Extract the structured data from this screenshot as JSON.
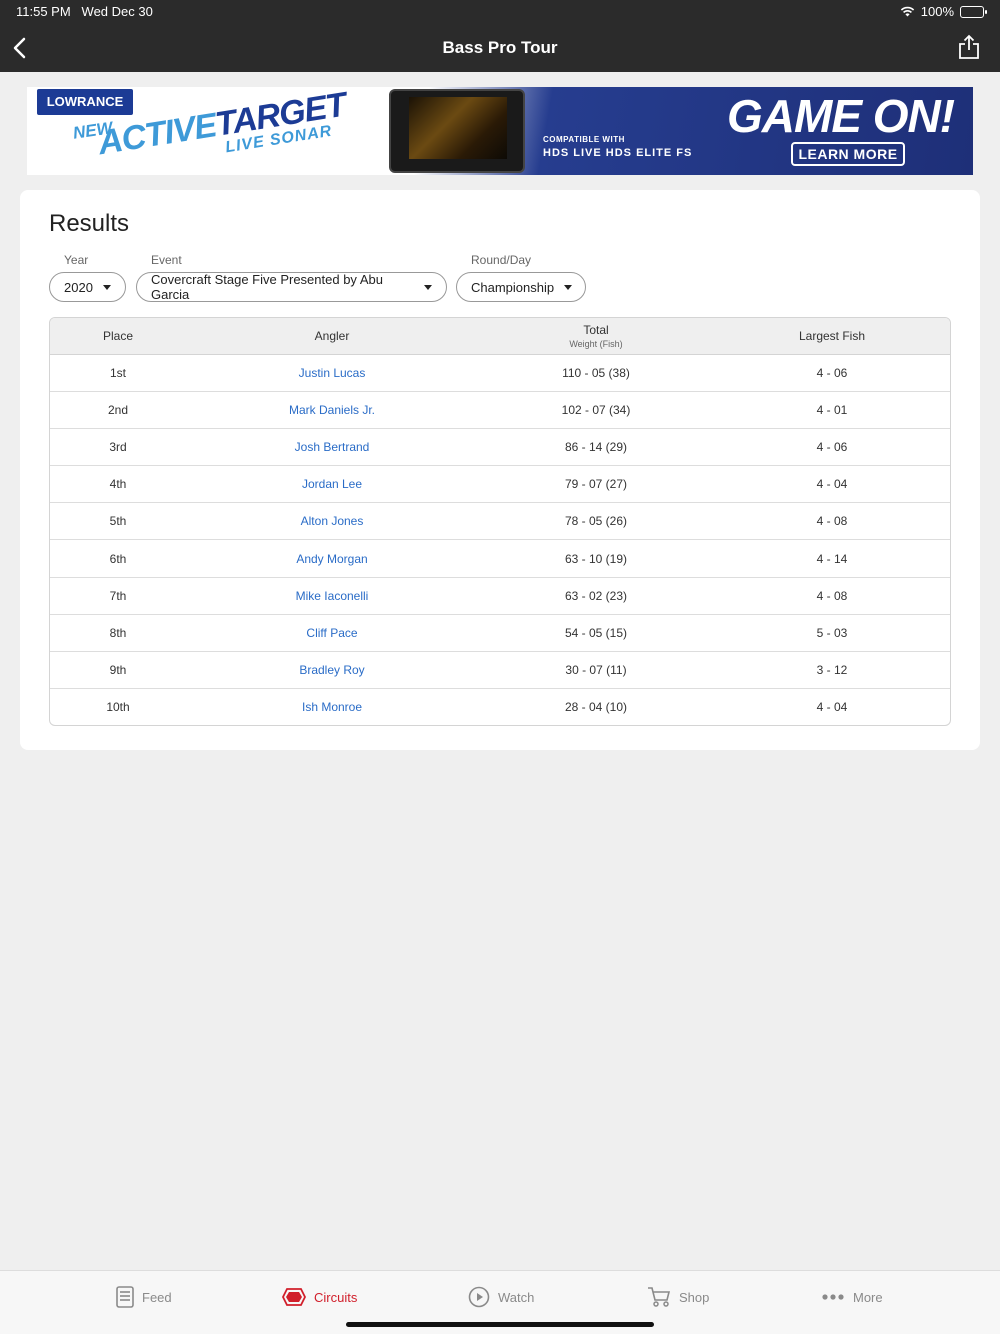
{
  "status": {
    "time": "11:55 PM",
    "date": "Wed Dec 30",
    "battery": "100%",
    "battery_level": 1.0
  },
  "nav": {
    "title": "Bass Pro Tour"
  },
  "ad": {
    "brand": "LOWRANCE",
    "new_text": "NEW",
    "product_part1": "ACTIVE",
    "product_part2": "TARGET",
    "subtitle": "LIVE SONAR",
    "device_brand": "LOWRANCE",
    "compatible": "COMPATIBLE WITH",
    "compatible_models": "HDS LIVE  HDS  ELITE FS",
    "headline": "GAME ON!",
    "cta": "LEARN MORE"
  },
  "results": {
    "title": "Results",
    "filters": {
      "year_label": "Year",
      "year_value": "2020",
      "event_label": "Event",
      "event_value": "Covercraft Stage Five Presented by Abu Garcia",
      "round_label": "Round/Day",
      "round_value": "Championship"
    },
    "columns": {
      "place": "Place",
      "angler": "Angler",
      "total": "Total",
      "total_sub": "Weight (Fish)",
      "largest": "Largest Fish"
    },
    "rows": [
      {
        "place": "1st",
        "angler": "Justin Lucas",
        "total": "110 - 05 (38)",
        "largest": "4 - 06"
      },
      {
        "place": "2nd",
        "angler": "Mark Daniels Jr.",
        "total": "102 - 07 (34)",
        "largest": "4 - 01"
      },
      {
        "place": "3rd",
        "angler": "Josh Bertrand",
        "total": "86 - 14 (29)",
        "largest": "4 - 06"
      },
      {
        "place": "4th",
        "angler": "Jordan Lee",
        "total": "79 - 07 (27)",
        "largest": "4 - 04"
      },
      {
        "place": "5th",
        "angler": "Alton Jones",
        "total": "78 - 05 (26)",
        "largest": "4 - 08"
      },
      {
        "place": "6th",
        "angler": "Andy Morgan",
        "total": "63 - 10 (19)",
        "largest": "4 - 14"
      },
      {
        "place": "7th",
        "angler": "Mike Iaconelli",
        "total": "63 - 02 (23)",
        "largest": "4 - 08"
      },
      {
        "place": "8th",
        "angler": "Cliff Pace",
        "total": "54 - 05 (15)",
        "largest": "5 - 03"
      },
      {
        "place": "9th",
        "angler": "Bradley Roy",
        "total": "30 - 07 (11)",
        "largest": "3 - 12"
      },
      {
        "place": "10th",
        "angler": "Ish Monroe",
        "total": "28 - 04 (10)",
        "largest": "4 - 04"
      }
    ]
  },
  "tabs": [
    {
      "label": "Feed",
      "icon": "feed-icon"
    },
    {
      "label": "Circuits",
      "icon": "circuits-icon",
      "active": true
    },
    {
      "label": "Watch",
      "icon": "play-icon"
    },
    {
      "label": "Shop",
      "icon": "cart-icon"
    },
    {
      "label": "More",
      "icon": "more-icon"
    }
  ],
  "colors": {
    "accent": "#d11f2b",
    "link": "#2a6cc7",
    "header_bg": "#2b2b2b",
    "ad_blue": "#1c3b95"
  }
}
